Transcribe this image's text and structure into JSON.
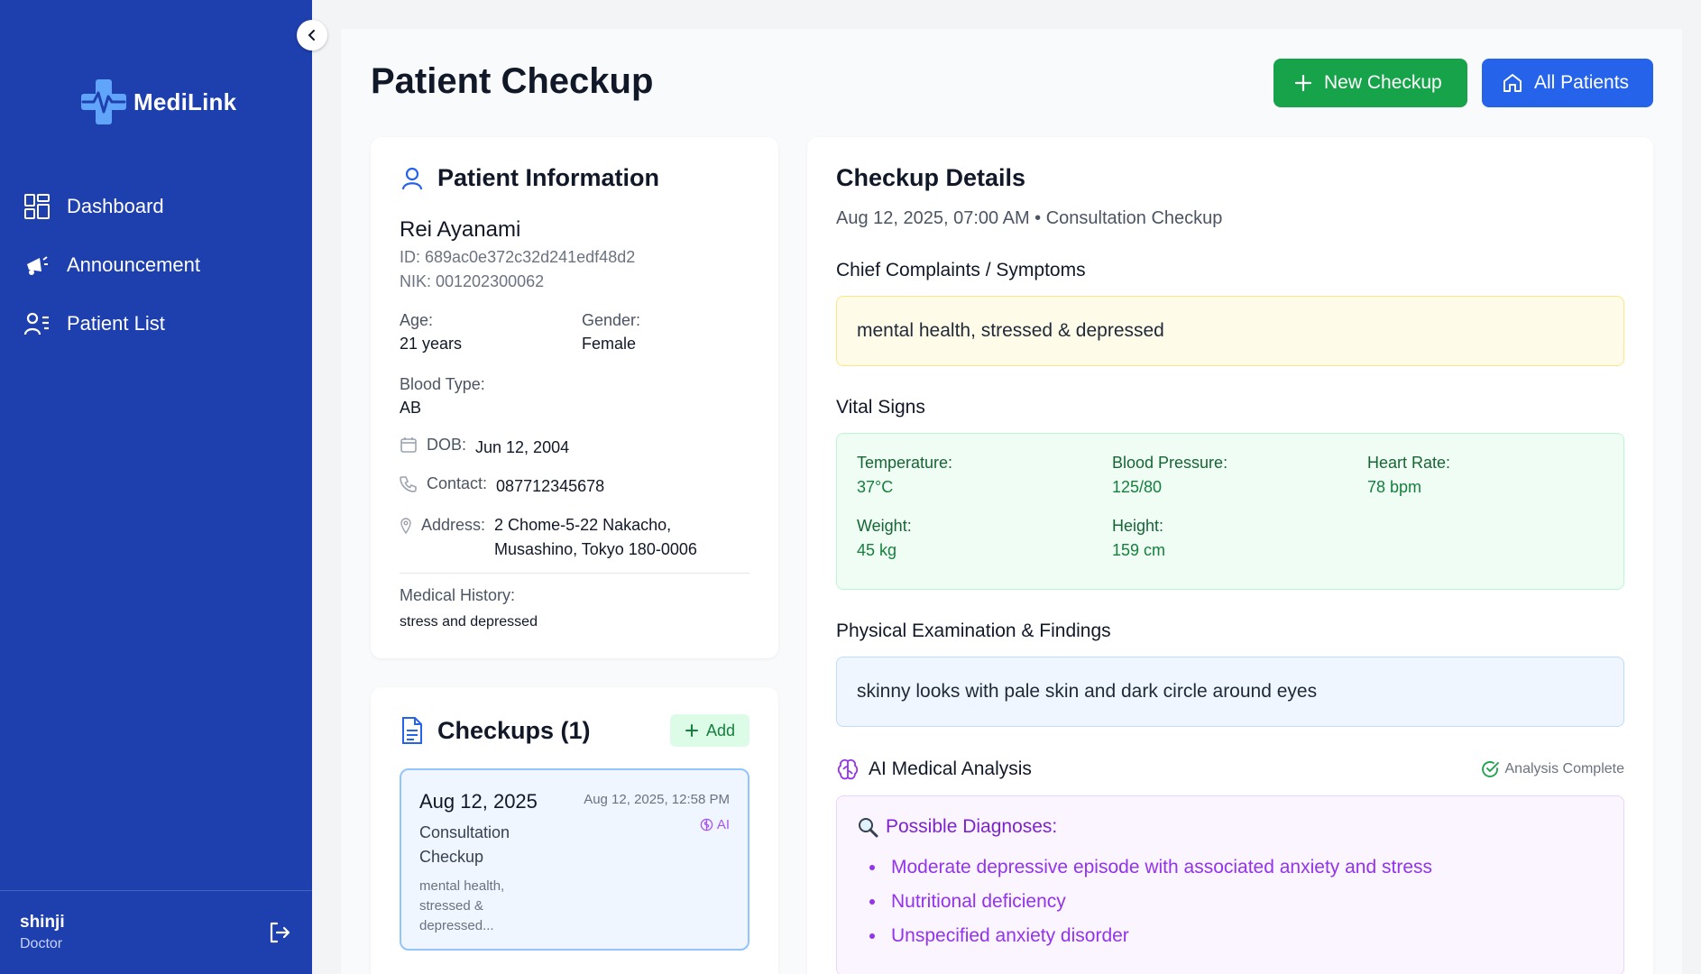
{
  "app": {
    "name": "MediLink"
  },
  "sidebar": {
    "items": [
      {
        "label": "Dashboard",
        "icon": "dashboard-icon"
      },
      {
        "label": "Announcement",
        "icon": "megaphone-icon"
      },
      {
        "label": "Patient List",
        "icon": "patient-list-icon"
      }
    ],
    "user": {
      "name": "shinji",
      "role": "Doctor"
    }
  },
  "header": {
    "title": "Patient Checkup",
    "new_checkup_label": "New Checkup",
    "all_patients_label": "All Patients"
  },
  "patient": {
    "section_title": "Patient Information",
    "name": "Rei Ayanami",
    "id_text": "ID: 689ac0e372c32d241edf48d2",
    "nik_text": "NIK: 001202300062",
    "age_label": "Age:",
    "age": "21 years",
    "gender_label": "Gender:",
    "gender": "Female",
    "blood_label": "Blood Type:",
    "blood": "AB",
    "dob_label": "DOB:",
    "dob": "Jun 12, 2004",
    "contact_label": "Contact:",
    "contact": "087712345678",
    "address_label": "Address:",
    "address_line1": "2 Chome-5-22 Nakacho,",
    "address_line2": "Musashino, Tokyo 180-0006",
    "history_label": "Medical History:",
    "history": "stress and depressed"
  },
  "checkups": {
    "title": "Checkups (1)",
    "add_label": "Add",
    "items": [
      {
        "date": "Aug 12, 2025",
        "type_line1": "Consultation",
        "type_line2": "Checkup",
        "desc_line1": "mental health,",
        "desc_line2": "stressed &",
        "desc_line3": "depressed...",
        "timestamp": "Aug 12, 2025, 12:58 PM",
        "ai_badge": "AI"
      }
    ]
  },
  "details": {
    "title": "Checkup Details",
    "subtitle": "Aug 12, 2025, 07:00 AM • Consultation Checkup",
    "complaints_title": "Chief Complaints / Symptoms",
    "complaints": "mental health, stressed & depressed",
    "vitals_title": "Vital Signs",
    "vitals": {
      "temperature_label": "Temperature:",
      "temperature": "37°C",
      "bp_label": "Blood Pressure:",
      "bp": "125/80",
      "hr_label": "Heart Rate:",
      "hr": "78 bpm",
      "weight_label": "Weight:",
      "weight": "45 kg",
      "height_label": "Height:",
      "height": "159 cm"
    },
    "exam_title": "Physical Examination & Findings",
    "exam": "skinny looks with pale skin and dark circle around eyes",
    "ai_title": "AI Medical Analysis",
    "ai_status": "Analysis Complete",
    "diagnoses_title": "Possible Diagnoses:",
    "diagnoses": [
      "Moderate depressive episode with associated anxiety and stress",
      "Nutritional deficiency",
      "Unspecified anxiety disorder"
    ]
  },
  "colors": {
    "sidebar_bg": "#1e3fae",
    "primary": "#2563eb",
    "success": "#16a34a",
    "ai_purple": "#9333ea"
  }
}
